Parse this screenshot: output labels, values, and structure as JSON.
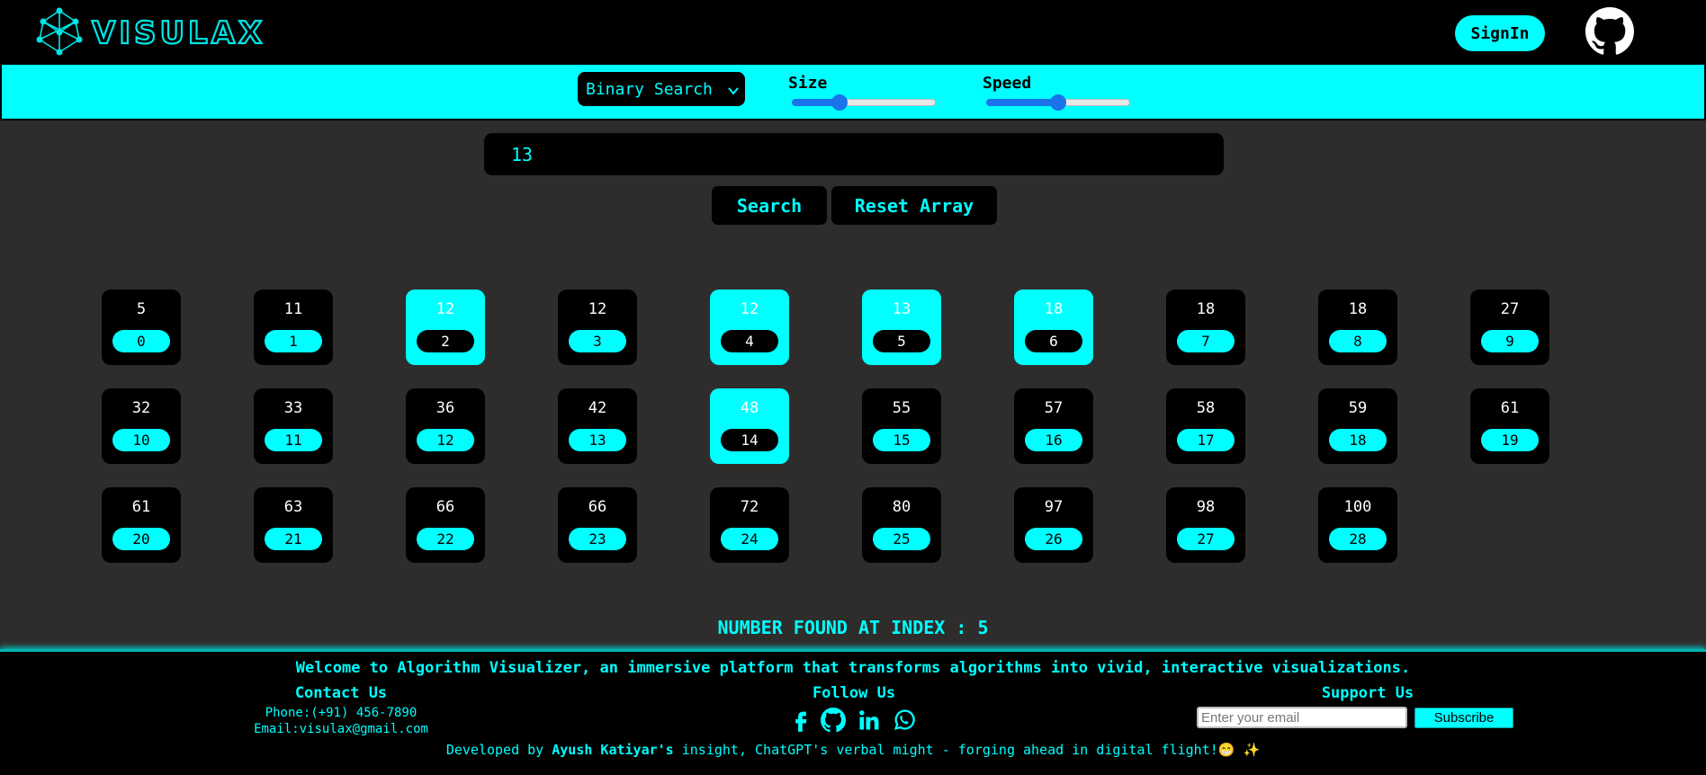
{
  "header": {
    "logo_text": "VISULAX",
    "signin_label": "SignIn"
  },
  "toolbar": {
    "algorithm_selected": "Binary Search",
    "size_label": "Size",
    "size_value": 0.33,
    "speed_label": "Speed",
    "speed_value": 0.5
  },
  "search": {
    "input_value": "13",
    "search_label": "Search",
    "reset_label": "Reset Array"
  },
  "array": {
    "values": [
      5,
      11,
      12,
      12,
      12,
      13,
      18,
      18,
      18,
      27,
      32,
      33,
      36,
      42,
      48,
      55,
      57,
      58,
      59,
      61,
      61,
      63,
      66,
      66,
      72,
      80,
      97,
      98,
      100
    ],
    "highlighted": [
      2,
      4,
      5,
      6,
      14
    ]
  },
  "result": "NUMBER FOUND AT INDEX : 5",
  "footer": {
    "welcome": "Welcome to Algorithm Visualizer, an immersive platform that transforms algorithms into vivid, interactive visualizations.",
    "contact_title": "Contact Us",
    "phone": "Phone:(+91) 456-7890",
    "email": "Email:visulax@gmail.com",
    "follow_title": "Follow Us",
    "social_icons": [
      "facebook-icon",
      "github-icon",
      "linkedin-icon",
      "whatsapp-icon"
    ],
    "support_title": "Support Us",
    "email_placeholder": "Enter your email",
    "subscribe_label": "Subscribe",
    "dev_prefix": "Developed by ",
    "dev_name": "Ayush Katiyar's",
    "dev_suffix": " insight, ChatGPT's verbal might - forging ahead in digital flight!😁 ✨"
  },
  "colors": {
    "accent": "#00ffff",
    "page_bg": "#2e2d2b",
    "panel": "#000000",
    "slider": "#1a73e8"
  }
}
